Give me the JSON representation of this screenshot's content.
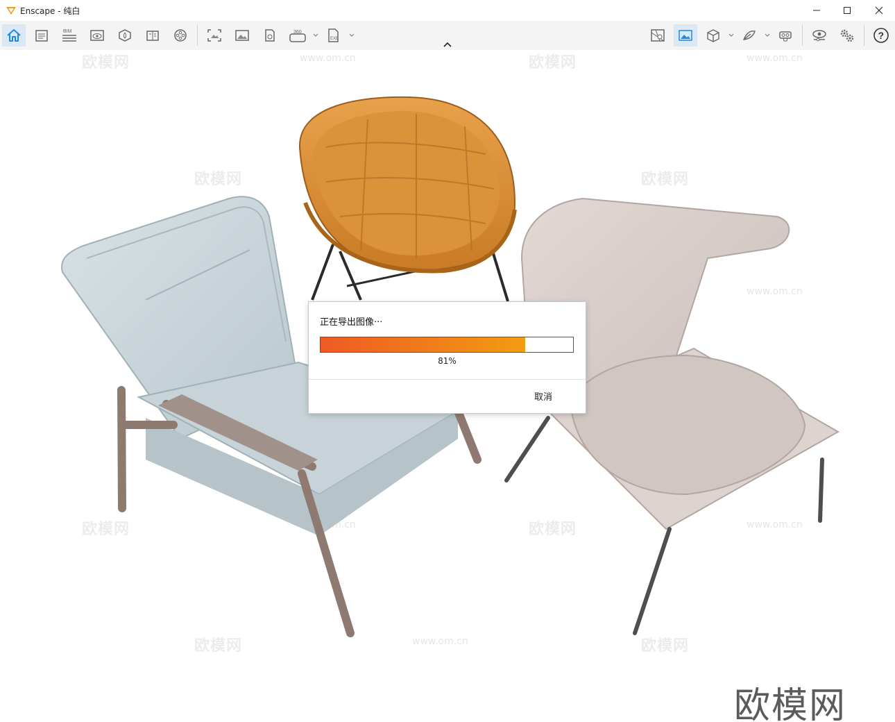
{
  "window": {
    "title": "Enscape - 纯白"
  },
  "toolbar": {
    "left_icons": [
      "home-icon",
      "notes-icon",
      "bim-icon",
      "view-eye-icon",
      "asset-library-icon",
      "book-icon",
      "video-reel-icon",
      "screenshot-icon",
      "image-icon",
      "batch-render-icon",
      "panorama-360-icon",
      "exe-export-icon"
    ],
    "right_icons": [
      "map-icon",
      "image-view-icon",
      "cube-icon",
      "sketch-icon",
      "vr-headset-icon",
      "visibility-icon",
      "settings-icon",
      "help-icon"
    ],
    "bim_label": "BIM",
    "label_360": "360",
    "exe_label": "EXE",
    "help_label": "?"
  },
  "dialog": {
    "title": "正在导出图像···",
    "progress_percent": 81,
    "progress_text": "81%",
    "cancel_label": "取消"
  },
  "watermark": {
    "text": "欧模网",
    "url": "www.om.cn",
    "corner_text": "欧模网"
  },
  "colors": {
    "accent": "#1e88e5",
    "progress_start": "#ee5a24",
    "progress_end": "#f39c12",
    "orange_chair": "#d98a2e",
    "blue_chair": "#c9d5da",
    "beige_chair": "#d6cbc7"
  }
}
